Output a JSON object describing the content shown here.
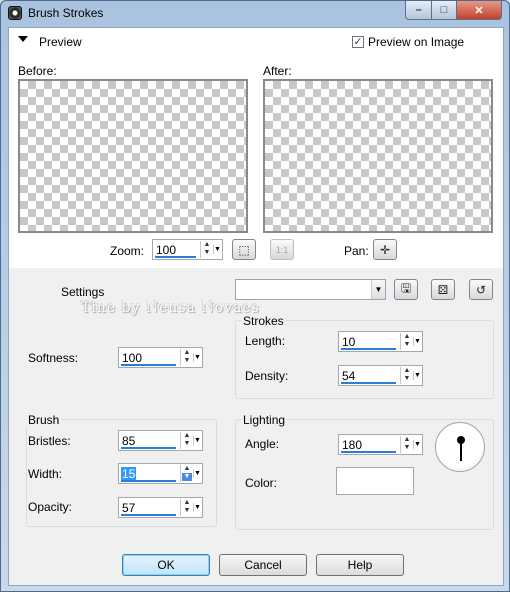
{
  "window": {
    "title": "Brush Strokes",
    "icon": "app-lens-icon"
  },
  "title_buttons": {
    "minimize": "minimize-icon",
    "maximize": "maximize-icon",
    "close": "close-icon"
  },
  "preview": {
    "section_label": "Preview",
    "preview_on_image_label": "Preview on Image",
    "preview_on_image_checked": true,
    "before_label": "Before:",
    "after_label": "After:",
    "zoom_label": "Zoom:",
    "zoom_value": "100",
    "pan_label": "Pan:"
  },
  "settings": {
    "label": "Settings",
    "preset_value": "",
    "icons": [
      "save-preset-icon",
      "randomize-dice-icon",
      "reset-icon"
    ]
  },
  "watermark": "Tine by Neusa Novaes",
  "general": {
    "softness_label": "Softness:",
    "softness_value": "100"
  },
  "strokes": {
    "title": "Strokes",
    "length_label": "Length:",
    "length_value": "10",
    "density_label": "Density:",
    "density_value": "54"
  },
  "brush": {
    "title": "Brush",
    "bristles_label": "Bristles:",
    "bristles_value": "85",
    "width_label": "Width:",
    "width_value": "15",
    "opacity_label": "Opacity:",
    "opacity_value": "57"
  },
  "lighting": {
    "title": "Lighting",
    "angle_label": "Angle:",
    "angle_value": "180",
    "color_label": "Color:",
    "color_value": "#ffffff"
  },
  "buttons": {
    "ok": "OK",
    "cancel": "Cancel",
    "help": "Help"
  },
  "colors": {
    "accent": "#2a7dd8",
    "selection": "#3399ff"
  }
}
